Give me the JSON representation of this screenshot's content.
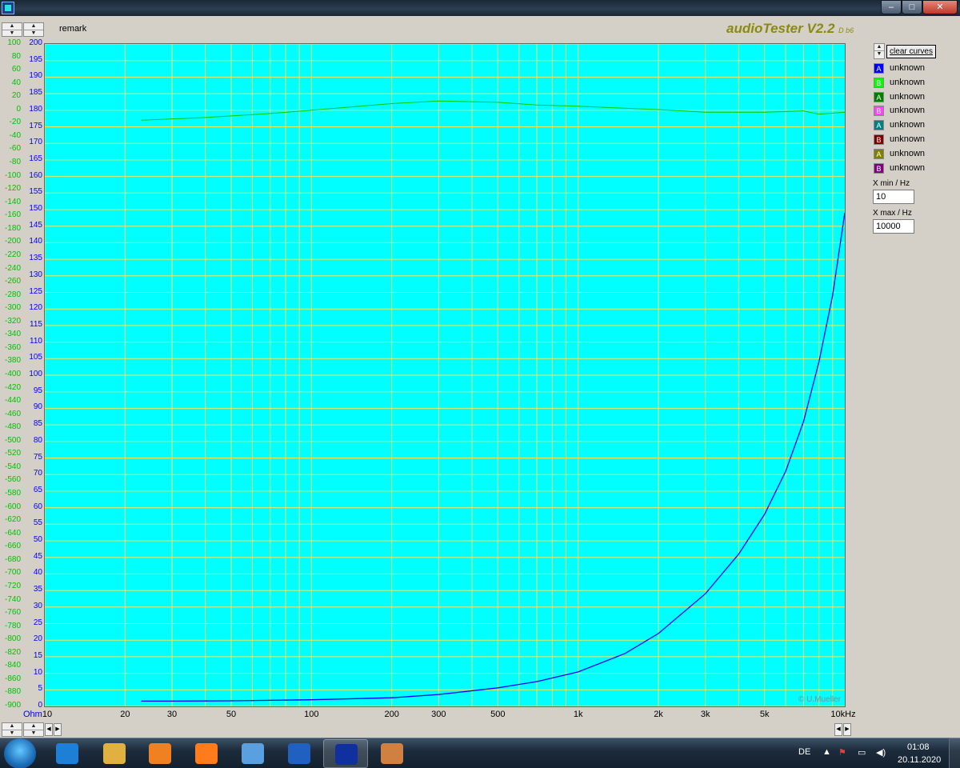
{
  "app": {
    "brand": "audioTester V2.2",
    "version_suffix": "D b6",
    "remark": "remark",
    "copyright": "© U.Mueller"
  },
  "window": {
    "minimize_symbol": "–",
    "maximize_symbol": "□",
    "close_symbol": "✕",
    "icons": [
      "app-icon",
      "minimize-icon",
      "maximize-icon",
      "close-icon"
    ]
  },
  "controls": {
    "clear_curves_label": "clear curves",
    "xmin_label": "X min / Hz",
    "xmin_value": "10",
    "xmax_label": "X max / Hz",
    "xmax_value": "10000"
  },
  "legend": [
    {
      "letter": "A",
      "label": "unknown",
      "color": "#0000ff"
    },
    {
      "letter": "B",
      "label": "unknown",
      "color": "#00ff00"
    },
    {
      "letter": "A",
      "label": "unknown",
      "color": "#008000"
    },
    {
      "letter": "B",
      "label": "unknown",
      "color": "#ff40ff"
    },
    {
      "letter": "A",
      "label": "unknown",
      "color": "#008080"
    },
    {
      "letter": "B",
      "label": "unknown",
      "color": "#800000"
    },
    {
      "letter": "A",
      "label": "unknown",
      "color": "#808000"
    },
    {
      "letter": "B",
      "label": "unknown",
      "color": "#800080"
    }
  ],
  "chart_data": {
    "type": "line",
    "background": "#00ffff",
    "grid_color": "#e8e860",
    "x_scale": "log",
    "xlim": [
      10,
      10000
    ],
    "x_tick_labels": [
      "10",
      "20",
      "30",
      "50",
      "100",
      "200",
      "300",
      "500",
      "1k",
      "2k",
      "3k",
      "5k",
      "10kHz"
    ],
    "x_tick_values": [
      10,
      20,
      30,
      50,
      100,
      200,
      300,
      500,
      1000,
      2000,
      3000,
      5000,
      10000
    ],
    "ylabel_left_unit": "Ohm",
    "y_left": {
      "min": 0,
      "max": 200,
      "step": 5,
      "color": "#0000ff"
    },
    "y_phase": {
      "min": -900,
      "max": 100,
      "step": 20,
      "color": "#00c000"
    },
    "series": [
      {
        "color": "#0000ff",
        "axis": "left",
        "x": [
          23,
          30,
          50,
          100,
          200,
          300,
          500,
          700,
          1000,
          1500,
          2000,
          3000,
          4000,
          5000,
          6000,
          7000,
          8000,
          9000,
          10000
        ],
        "y": [
          1.6,
          1.6,
          1.7,
          2.0,
          2.6,
          3.6,
          5.6,
          7.5,
          10.4,
          16,
          22,
          34,
          46,
          58,
          71,
          86,
          104,
          124,
          149
        ]
      },
      {
        "color": "#00cc00",
        "axis": "phase",
        "x": [
          23,
          40,
          70,
          100,
          200,
          300,
          500,
          700,
          1000,
          2000,
          3000,
          5000,
          7000,
          8000,
          10000
        ],
        "y": [
          -15,
          -11,
          -5,
          0,
          10,
          14,
          12,
          8,
          6,
          1,
          -3,
          -3,
          -1,
          -6,
          -3
        ]
      }
    ]
  },
  "taskbar": {
    "apps": [
      {
        "name": "internet-explorer",
        "color": "#1e7fd6",
        "active": false
      },
      {
        "name": "file-explorer",
        "color": "#e0b040",
        "active": false
      },
      {
        "name": "media-player",
        "color": "#f08020",
        "active": false
      },
      {
        "name": "firefox",
        "color": "#ff7b1c",
        "active": false
      },
      {
        "name": "image-viewer",
        "color": "#5aa0e0",
        "active": false
      },
      {
        "name": "app-m",
        "color": "#2060c0",
        "active": false
      },
      {
        "name": "audiotester",
        "color": "#1030a0",
        "active": true
      },
      {
        "name": "paint",
        "color": "#d08040",
        "active": false
      }
    ],
    "language": "DE",
    "time": "01:08",
    "date": "20.11.2020"
  }
}
